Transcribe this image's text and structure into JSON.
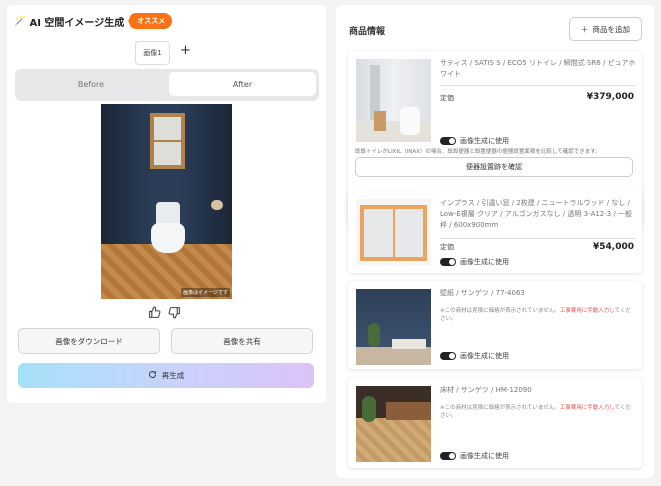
{
  "left": {
    "title": "AI 空間イメージ生成",
    "badge": "オススメ",
    "image_tab": "画像1",
    "add_tab": "+",
    "segment": {
      "before": "Before",
      "after": "After"
    },
    "photo_caption": "画像はイメージです",
    "download_label": "画像をダウンロード",
    "share_label": "画像を共有",
    "regenerate_label": "再生成"
  },
  "right": {
    "title": "商品情報",
    "add_product_label": "商品を追加",
    "products": [
      {
        "name": "サティス / SATIS S / ECO5 リトイレ / 瞬間式 SR6 / ピュアホワイト",
        "price_label": "定価",
        "price": "¥379,000",
        "toggle_label": "画像生成に使用",
        "bottom_note": "既設トイレがLIXIL（INAX）の場合、既設便器と設置便器の便器設置面積を比較して確認できます。",
        "check_button": "便器設置跡を確認"
      },
      {
        "name": "インプラス / 引違い窓 / 2枚建 / ニュートラルウッド / なし / Low-E複層 クリア / アルゴンガスなし / 透明 3-A12-3 / 一般枠 / 600x900mm",
        "price_label": "定価",
        "price": "¥54,000",
        "toggle_label": "画像生成に使用"
      },
      {
        "name": "壁紙 / サンゲツ / 77-4063",
        "note_prefix": "※この商材は見積に価格が表示されていません。",
        "note_red": "工事費用に手動入力して",
        "note_suffix": "ください。",
        "toggle_label": "画像生成に使用"
      },
      {
        "name": "床材 / サンゲツ / HM-12090",
        "note_prefix": "※この商材は見積に価格が表示されていません。",
        "note_red": "工事費用に手動入力して",
        "note_suffix": "ください。",
        "toggle_label": "画像生成に使用"
      }
    ]
  },
  "icons": {
    "title": "magic-wand-icon",
    "regenerate": "refresh-icon",
    "like": "thumbs-up-icon",
    "dislike": "thumbs-down-icon",
    "add": "plus-icon"
  },
  "colors": {
    "badge": "#f97316",
    "toggle_on": "#222222"
  }
}
